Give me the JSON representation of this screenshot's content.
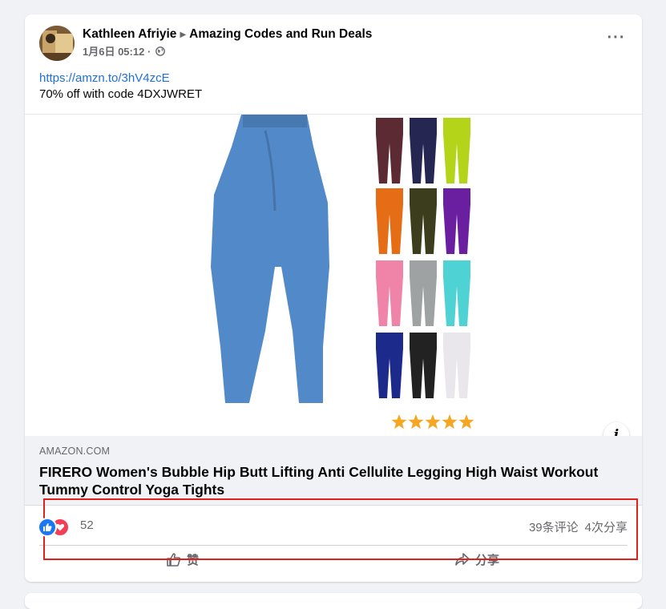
{
  "post": {
    "author": "Kathleen Afriyie",
    "group": "Amazing Codes and Run Deals",
    "timestamp": "1月6日 05:12",
    "separator": "·",
    "link_url": "https://amzn.to/3hV4zcE",
    "text": "70% off with code 4DXJWRET",
    "more_label": "···"
  },
  "link_preview": {
    "domain": "AMAZON.COM",
    "title": "FIRERO Women's Bubble Hip Butt Lifting Anti Cellulite Legging High Waist Workout Tummy Control Yoga Tights",
    "info_label": "i",
    "product_colors": [
      "#5b2a33",
      "#252652",
      "#b4d41a",
      "#e46d16",
      "#3b3d1d",
      "#6a1fa0",
      "#ef84a8",
      "#9ea2a3",
      "#4ed2d4",
      "#1c2a8c",
      "#222222",
      "#e9e6ec"
    ],
    "main_color": "#5189c9",
    "star_color": "#f5a623",
    "rating_stars": 5
  },
  "engagement": {
    "reaction_count": "52",
    "comments": "39条评论",
    "shares": "4次分享",
    "reactions": [
      "like-icon",
      "love-icon"
    ]
  },
  "actions": {
    "like_label": "赞",
    "share_label": "分享"
  },
  "colors": {
    "link": "#216fdb",
    "like": "#1877f2",
    "love": "#f33e58",
    "highlight": "#e0201b"
  }
}
